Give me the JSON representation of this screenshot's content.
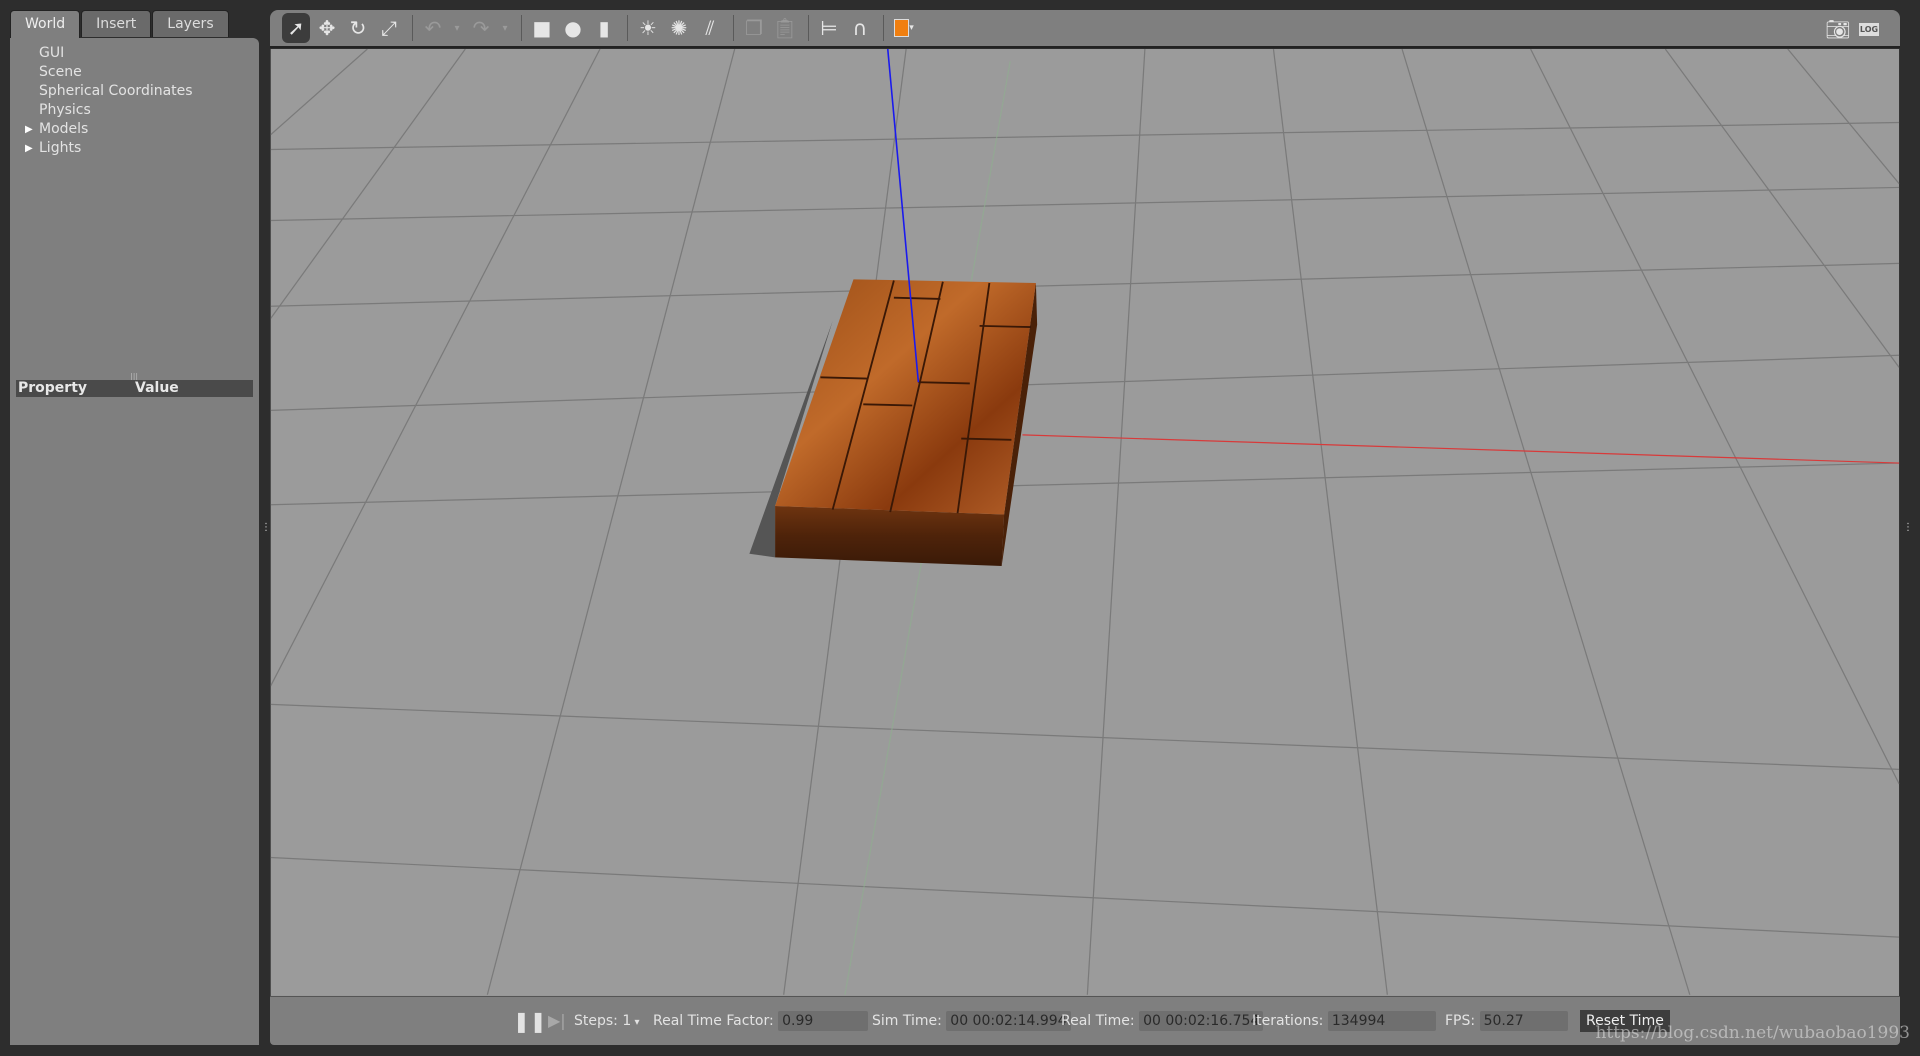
{
  "left_panel": {
    "tabs": [
      {
        "label": "World",
        "active": true
      },
      {
        "label": "Insert"
      },
      {
        "label": "Layers"
      }
    ],
    "tree": [
      {
        "label": "GUI",
        "expandable": false
      },
      {
        "label": "Scene",
        "expandable": false
      },
      {
        "label": "Spherical Coordinates",
        "expandable": false
      },
      {
        "label": "Physics",
        "expandable": false
      },
      {
        "label": "Models",
        "expandable": true
      },
      {
        "label": "Lights",
        "expandable": true
      }
    ],
    "property_header": {
      "property": "Property",
      "value": "Value"
    }
  },
  "toolbar": {
    "tools": [
      "select-arrow-icon",
      "translate-icon",
      "rotate-icon",
      "scale-icon",
      "undo-icon",
      "redo-icon",
      "box-icon",
      "sphere-icon",
      "cylinder-icon",
      "point-light-icon",
      "spot-light-icon",
      "directional-light-icon",
      "copy-icon",
      "paste-icon",
      "align-icon",
      "snap-magnet-icon",
      "view-angle-icon"
    ],
    "right": [
      "screenshot-camera-icon",
      "log-download-icon"
    ],
    "right_label": "LOG"
  },
  "bottom_bar": {
    "steps_label": "Steps:",
    "steps_value": "1",
    "rtf_label": "Real Time Factor:",
    "rtf_value": "0.99",
    "sim_time_label": "Sim Time:",
    "sim_time_value": "00 00:02:14.994",
    "real_time_label": "Real Time:",
    "real_time_value": "00 00:02:16.754",
    "iterations_label": "Iterations:",
    "iterations_value": "134994",
    "fps_label": "FPS:",
    "fps_value": "50.27",
    "reset_label": "Reset Time"
  },
  "watermark": "https://blog.csdn.net/wubaobao1993",
  "colors": {
    "ground": "#9a9a9a",
    "x_axis": "#e03030",
    "y_axis": "#7fbf7f",
    "z_axis": "#1a1aee",
    "wood": "#8a3e10",
    "selected_tool": "#3c3c3c",
    "accent_orange": "#f07f10"
  }
}
